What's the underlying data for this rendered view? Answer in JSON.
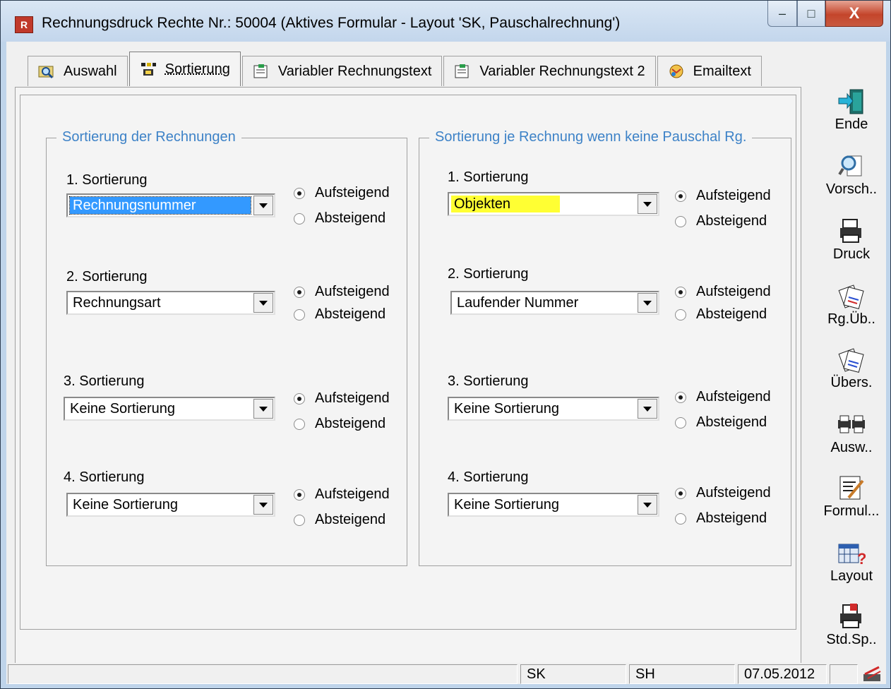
{
  "window": {
    "title": "Rechnungsdruck Rechte Nr.: 50004  (Aktives Formular - Layout 'SK, Pauschalrechnung')",
    "minimize": "–",
    "maximize": "□",
    "close": "X"
  },
  "tabs": [
    {
      "label": "Auswahl",
      "icon": "folder-search-icon"
    },
    {
      "label": "Sortierung",
      "icon": "sort-icon",
      "active": true
    },
    {
      "label": "Variabler Rechnungstext",
      "icon": "document-edit-icon"
    },
    {
      "label": "Variabler Rechnungstext 2",
      "icon": "document-edit-icon"
    },
    {
      "label": "Emailtext",
      "icon": "email-icon"
    }
  ],
  "left_group": {
    "legend": "Sortierung der Rechnungen",
    "rows": [
      {
        "label": "1. Sortierung",
        "value": "Rechnungsnummer",
        "asc": "Aufsteigend",
        "desc": "Absteigend",
        "checked": "asc"
      },
      {
        "label": "2. Sortierung",
        "value": "Rechnungsart",
        "asc": "Aufsteigend",
        "desc": "Absteigend",
        "checked": "asc"
      },
      {
        "label": "3. Sortierung",
        "value": "Keine Sortierung",
        "asc": "Aufsteigend",
        "desc": "Absteigend",
        "checked": "asc"
      },
      {
        "label": "4. Sortierung",
        "value": "Keine Sortierung",
        "asc": "Aufsteigend",
        "desc": "Absteigend",
        "checked": "asc"
      }
    ]
  },
  "right_group": {
    "legend": "Sortierung je Rechnung wenn keine Pauschal Rg.",
    "rows": [
      {
        "label": "1. Sortierung",
        "value": "Objekten",
        "asc": "Aufsteigend",
        "desc": "Absteigend",
        "checked": "asc"
      },
      {
        "label": "2. Sortierung",
        "value": "Laufender Nummer",
        "asc": "Aufsteigend",
        "desc": "Absteigend",
        "checked": "asc"
      },
      {
        "label": "3. Sortierung",
        "value": "Keine Sortierung",
        "asc": "Aufsteigend",
        "desc": "Absteigend",
        "checked": "asc"
      },
      {
        "label": "4. Sortierung",
        "value": "Keine Sortierung",
        "asc": "Aufsteigend",
        "desc": "Absteigend",
        "checked": "asc"
      }
    ]
  },
  "toolbar": [
    {
      "label": "Ende",
      "icon": "exit-door-icon"
    },
    {
      "label": "Vorsch..",
      "icon": "preview-magnifier-icon"
    },
    {
      "label": "Druck",
      "icon": "printer-icon"
    },
    {
      "label": "Rg.Üb..",
      "icon": "invoice-transfer-icon"
    },
    {
      "label": "Übers.",
      "icon": "overview-icon"
    },
    {
      "label": "Ausw..",
      "icon": "evaluation-printers-icon"
    },
    {
      "label": "Formul...",
      "icon": "form-edit-icon"
    },
    {
      "label": "Layout",
      "icon": "layout-help-icon"
    },
    {
      "label": "Std.Sp..",
      "icon": "save-standard-icon"
    }
  ],
  "status": {
    "user": "SK",
    "branch": "SH",
    "date": "07.05.2012"
  },
  "colors": {
    "legend": "#3d82c7",
    "selection": "#3399ff",
    "highlight": "#ffff33"
  }
}
